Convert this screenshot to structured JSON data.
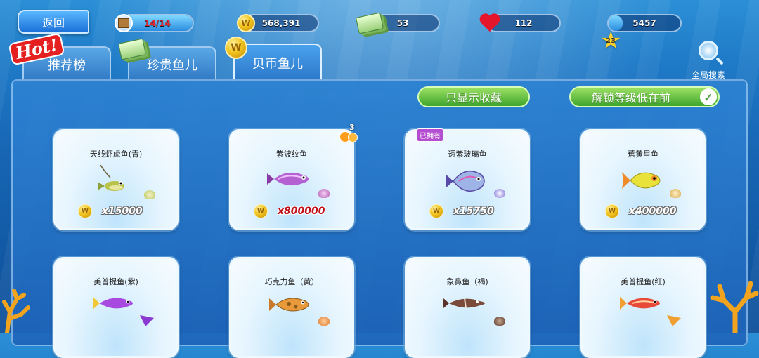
{
  "top_bar": {
    "back_label": "返回",
    "stats": {
      "energy": {
        "value": "14/14",
        "fill": 1.0,
        "icon": "crate-icon"
      },
      "coins": {
        "value": "568,391",
        "icon": "coin-icon"
      },
      "cash": {
        "value": "53",
        "icon": "cash-icon"
      },
      "hearts": {
        "value": "112",
        "icon": "heart-icon"
      },
      "level": {
        "badge": "23",
        "value": "5457",
        "fill": 0.2,
        "icon": "star-icon"
      }
    }
  },
  "tabs": {
    "hot_label": "Hot!",
    "items": [
      {
        "label": "推荐榜",
        "icon": "",
        "active": false
      },
      {
        "label": "珍贵鱼儿",
        "icon": "cash-icon",
        "active": false
      },
      {
        "label": "贝币鱼儿",
        "icon": "coin-icon",
        "active": true
      }
    ]
  },
  "search": {
    "label": "全局搜素",
    "icon": "magnifier-icon"
  },
  "filters": {
    "favorites_label": "只显示收藏",
    "sort_label": "解锁等级低在前",
    "sort_checked": true
  },
  "cards": [
    {
      "name": "天线虾虎鱼(青)",
      "price": "x15000",
      "price_red": false,
      "owned": false,
      "badge": ""
    },
    {
      "name": "紫波纹鱼",
      "price": "x800000",
      "price_red": true,
      "owned": false,
      "badge": "3"
    },
    {
      "name": "透紫玻璃鱼",
      "price": "x15750",
      "price_red": false,
      "owned": true,
      "owned_label": "已拥有",
      "badge": ""
    },
    {
      "name": "蕉黄星鱼",
      "price": "x400000",
      "price_red": false,
      "owned": false,
      "badge": ""
    },
    {
      "name": "美普提鱼(紫)",
      "price": "",
      "price_red": false,
      "owned": false,
      "badge": ""
    },
    {
      "name": "巧克力鱼（黄）",
      "price": "",
      "price_red": false,
      "owned": false,
      "badge": ""
    },
    {
      "name": "象鼻鱼（褐)",
      "price": "",
      "price_red": false,
      "owned": false,
      "badge": ""
    },
    {
      "name": "美普提鱼(红)",
      "price": "",
      "price_red": false,
      "owned": false,
      "badge": ""
    }
  ],
  "colors": {
    "ocean": "#1f7bc8",
    "button_green": "#3ea52c",
    "coin_gold": "#f2c51f",
    "price_red": "#c0101a",
    "owned_purple": "#b44dd0"
  }
}
